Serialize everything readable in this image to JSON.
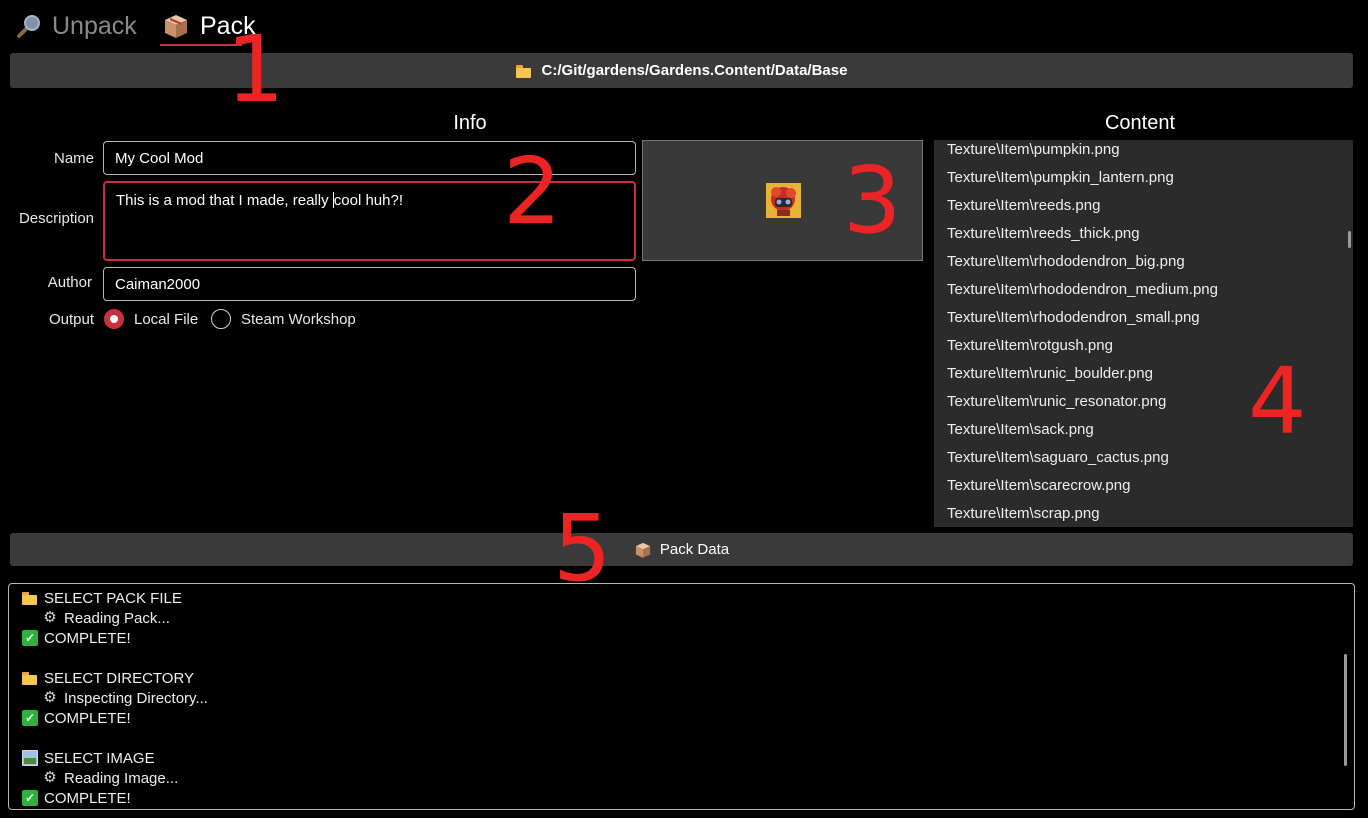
{
  "tabs": [
    {
      "label": "Unpack",
      "icon": "magnifier-icon",
      "active": false
    },
    {
      "label": "Pack",
      "icon": "box-icon",
      "active": true
    }
  ],
  "path_bar": {
    "icon": "folder-icon",
    "path": "C:/Git/gardens/Gardens.Content/Data/Base"
  },
  "info": {
    "title": "Info",
    "name_label": "Name",
    "name_value": "My Cool Mod",
    "description_label": "Description",
    "description_before_caret": "This is a mod that I made, really ",
    "description_after_caret": "cool huh?!",
    "author_label": "Author",
    "author_value": "Caiman2000",
    "output_label": "Output",
    "output_options": [
      "Local File",
      "Steam Workshop"
    ],
    "output_selected": "Local File"
  },
  "content": {
    "title": "Content",
    "items": [
      "Texture\\Item\\pumpkin.png",
      "Texture\\Item\\pumpkin_lantern.png",
      "Texture\\Item\\reeds.png",
      "Texture\\Item\\reeds_thick.png",
      "Texture\\Item\\rhododendron_big.png",
      "Texture\\Item\\rhododendron_medium.png",
      "Texture\\Item\\rhododendron_small.png",
      "Texture\\Item\\rotgush.png",
      "Texture\\Item\\runic_boulder.png",
      "Texture\\Item\\runic_resonator.png",
      "Texture\\Item\\sack.png",
      "Texture\\Item\\saguaro_cactus.png",
      "Texture\\Item\\scarecrow.png",
      "Texture\\Item\\scrap.png"
    ]
  },
  "pack_button": {
    "icon": "box-icon",
    "label": "Pack Data"
  },
  "log": [
    {
      "icon": "folder-icon",
      "text": "SELECT PACK FILE",
      "indent": false
    },
    {
      "icon": "gear-icon",
      "text": "Reading Pack...",
      "indent": true
    },
    {
      "icon": "check-icon",
      "text": "COMPLETE!",
      "indent": false
    },
    {
      "icon": "folder-icon",
      "text": "SELECT DIRECTORY",
      "indent": false
    },
    {
      "icon": "gear-icon",
      "text": "Inspecting Directory...",
      "indent": true
    },
    {
      "icon": "check-icon",
      "text": "COMPLETE!",
      "indent": false
    },
    {
      "icon": "image-icon",
      "text": "SELECT IMAGE",
      "indent": false
    },
    {
      "icon": "gear-icon",
      "text": "Reading Image...",
      "indent": true
    },
    {
      "icon": "check-icon",
      "text": "COMPLETE!",
      "indent": false
    }
  ],
  "annotations": [
    "1",
    "2",
    "3",
    "4",
    "5"
  ],
  "colors": {
    "accent": "#c8313b",
    "annotation": "#ee2424",
    "panel": "#3a3a3a",
    "list_bg": "#2b2b2b"
  }
}
